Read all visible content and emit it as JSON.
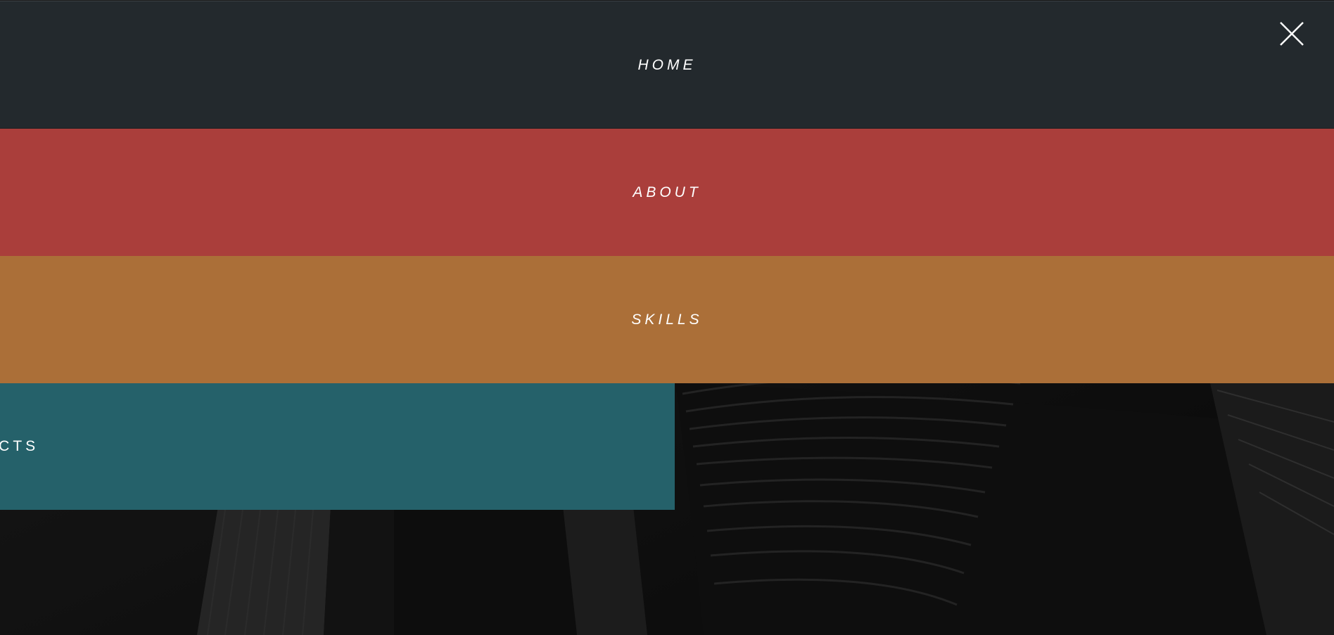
{
  "menu": {
    "items": [
      {
        "label": "HOME",
        "color": "#23292d"
      },
      {
        "label": "ABOUT",
        "color": "#aa3e3b"
      },
      {
        "label": "SKILLS",
        "color": "#ab6f38"
      },
      {
        "label": "UCTS",
        "color": "#25616a"
      }
    ]
  },
  "close": {
    "icon": "close-icon"
  },
  "background": {
    "description_icon": "building-photo"
  }
}
